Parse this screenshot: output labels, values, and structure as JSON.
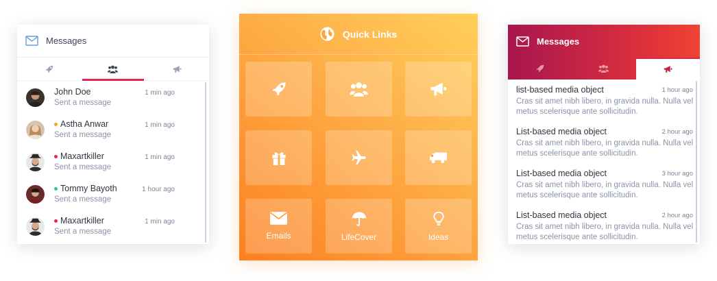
{
  "messages_panel": {
    "title": "Messages",
    "tabs": [
      {
        "icon": "rocket-icon",
        "active": false
      },
      {
        "icon": "users-icon",
        "active": true
      },
      {
        "icon": "bullhorn-icon",
        "active": false
      }
    ],
    "items": [
      {
        "name": "John Doe",
        "message": "Sent a message",
        "time": "1 min ago",
        "status_color": ""
      },
      {
        "name": "Astha Anwar",
        "message": "Sent a message",
        "time": "1 min ago",
        "status_color": "#f5a623"
      },
      {
        "name": "Maxartkiller",
        "message": "Sent a message",
        "time": "1 min ago",
        "status_color": "#e6264f"
      },
      {
        "name": "Tommy Bayoth",
        "message": "Sent a message",
        "time": "1 hour ago",
        "status_color": "#20c997"
      },
      {
        "name": "Maxartkiller",
        "message": "Sent a message",
        "time": "1 min ago",
        "status_color": "#e6264f"
      }
    ]
  },
  "quick_links": {
    "title": "Quick Links",
    "tiles": [
      {
        "icon": "rocket-icon",
        "label": ""
      },
      {
        "icon": "users-icon",
        "label": ""
      },
      {
        "icon": "bullhorn-icon",
        "label": ""
      },
      {
        "icon": "gift-icon",
        "label": ""
      },
      {
        "icon": "plane-icon",
        "label": ""
      },
      {
        "icon": "truck-icon",
        "label": ""
      },
      {
        "icon": "envelope-icon",
        "label": "Emails"
      },
      {
        "icon": "umbrella-icon",
        "label": "LifeCover"
      },
      {
        "icon": "lightbulb-icon",
        "label": "Ideas"
      }
    ]
  },
  "messages_panel_alt": {
    "title": "Messages",
    "tabs": [
      {
        "icon": "rocket-icon",
        "active": false
      },
      {
        "icon": "users-icon",
        "active": false
      },
      {
        "icon": "bullhorn-icon",
        "active": true
      }
    ],
    "items": [
      {
        "title": "list-based media object",
        "time": "1 hour ago",
        "body": "Cras sit amet nibh libero, in gravida nulla. Nulla vel metus scelerisque ante sollicitudin."
      },
      {
        "title": "List-based media object",
        "time": "2 hour ago",
        "body": "Cras sit amet nibh libero, in gravida nulla. Nulla vel metus scelerisque ante sollicitudin."
      },
      {
        "title": "List-based media object",
        "time": "3 hour ago",
        "body": "Cras sit amet nibh libero, in gravida nulla. Nulla vel metus scelerisque ante sollicitudin."
      },
      {
        "title": "List-based media object",
        "time": "2 hour ago",
        "body": "Cras sit amet nibh libero, in gravida nulla. Nulla vel metus scelerisque ante sollicitudin."
      }
    ]
  },
  "colors": {
    "accent_red": "#e6264f",
    "orange_start": "#fd7f1f",
    "orange_end": "#ffd05a",
    "crimson_start": "#a8164f",
    "crimson_end": "#ee4433"
  }
}
